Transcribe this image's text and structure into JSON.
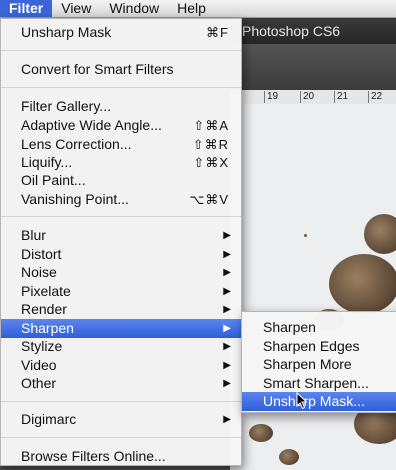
{
  "menubar": {
    "items": [
      "Filter",
      "View",
      "Window",
      "Help"
    ],
    "active": "Filter"
  },
  "app": {
    "window_title": "Photoshop CS6",
    "ruler_ticks": [
      "19",
      "20",
      "21",
      "22"
    ]
  },
  "filter_menu": {
    "items": [
      {
        "label": "Unsharp Mask",
        "shortcut": "⌘F"
      },
      {
        "label": "Convert for Smart Filters"
      },
      {
        "label": "Filter Gallery..."
      },
      {
        "label": "Adaptive Wide Angle...",
        "shortcut": "⇧⌘A"
      },
      {
        "label": "Lens Correction...",
        "shortcut": "⇧⌘R"
      },
      {
        "label": "Liquify...",
        "shortcut": "⇧⌘X"
      },
      {
        "label": "Oil Paint..."
      },
      {
        "label": "Vanishing Point...",
        "shortcut": "⌥⌘V"
      },
      {
        "label": "Blur",
        "submenu": true
      },
      {
        "label": "Distort",
        "submenu": true
      },
      {
        "label": "Noise",
        "submenu": true
      },
      {
        "label": "Pixelate",
        "submenu": true
      },
      {
        "label": "Render",
        "submenu": true
      },
      {
        "label": "Sharpen",
        "submenu": true,
        "highlighted": true
      },
      {
        "label": "Stylize",
        "submenu": true
      },
      {
        "label": "Video",
        "submenu": true
      },
      {
        "label": "Other",
        "submenu": true
      },
      {
        "label": "Digimarc",
        "submenu": true
      },
      {
        "label": "Browse Filters Online..."
      }
    ]
  },
  "sharpen_submenu": {
    "items": [
      {
        "label": "Sharpen"
      },
      {
        "label": "Sharpen Edges"
      },
      {
        "label": "Sharpen More"
      },
      {
        "label": "Smart Sharpen..."
      },
      {
        "label": "Unsharp Mask...",
        "highlighted": true
      }
    ]
  },
  "icons": {
    "submenu_arrow": "▶",
    "cursor": "arrow-pointer-icon"
  },
  "colors": {
    "highlight": "#3a66d9",
    "menu_bg": "#f6f6f6"
  }
}
